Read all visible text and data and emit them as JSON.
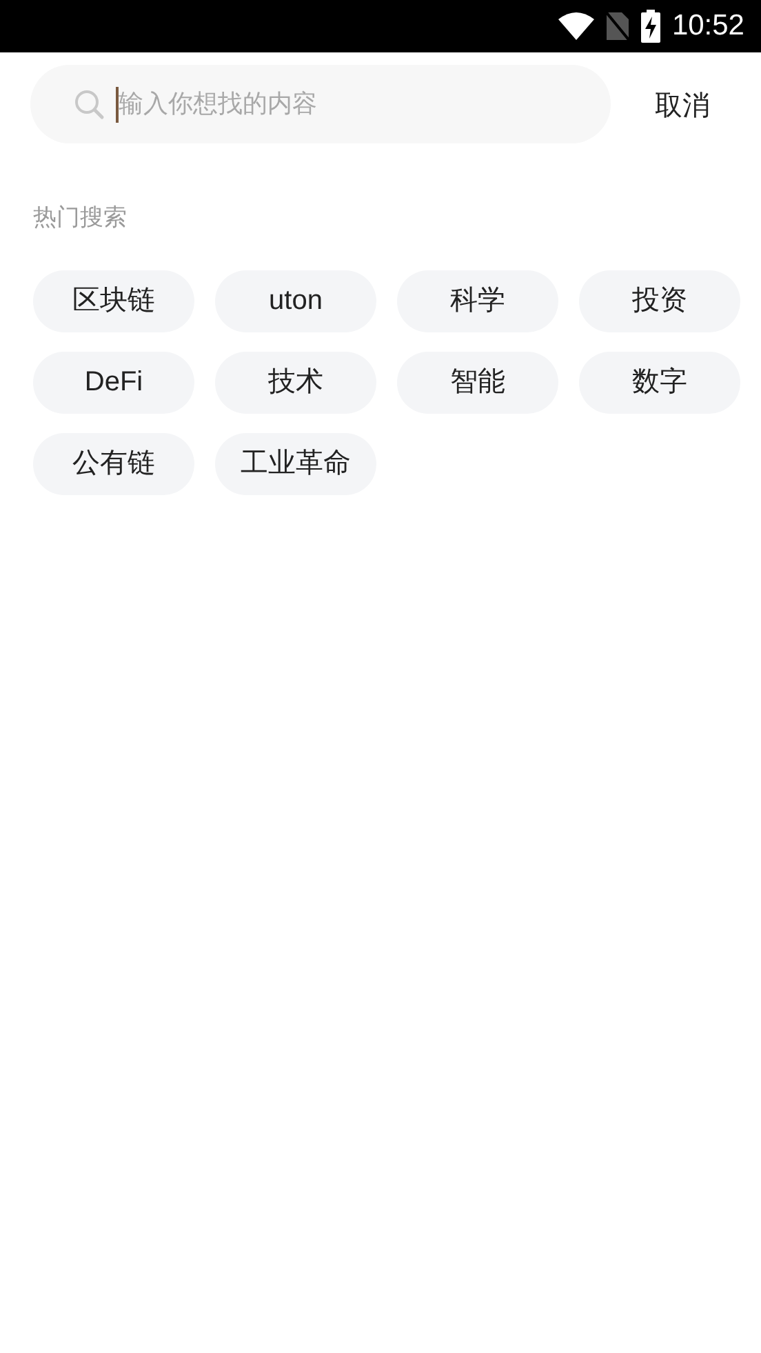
{
  "status_bar": {
    "time": "10:52"
  },
  "search": {
    "placeholder": "输入你想找的内容",
    "cancel": "取消"
  },
  "hot_search": {
    "title": "热门搜索",
    "tags": [
      "区块链",
      "uton",
      "科学",
      "投资",
      "DeFi",
      "技术",
      "智能",
      "数字",
      "公有链",
      "工业革命"
    ]
  }
}
